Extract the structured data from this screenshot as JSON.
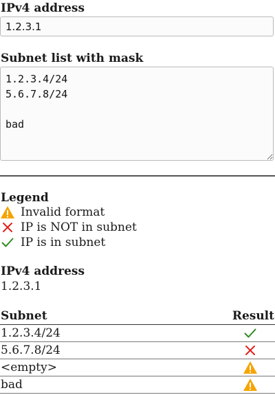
{
  "form": {
    "ip_label": "IPv4 address",
    "ip_value": "1.2.3.1",
    "subnets_label": "Subnet list with mask",
    "subnets_value": "1.2.3.4/24\n5.6.7.8/24\n\nbad"
  },
  "legend": {
    "title": "Legend",
    "items": [
      {
        "icon": "warning-icon",
        "text": "Invalid format",
        "color": "#f5a400"
      },
      {
        "icon": "cross-icon",
        "text": "IP is NOT in subnet",
        "color": "#e0201b"
      },
      {
        "icon": "check-icon",
        "text": "IP is in subnet",
        "color": "#2e8b1e"
      }
    ]
  },
  "summary": {
    "ip_title": "IPv4 address",
    "ip_value": "1.2.3.1"
  },
  "results": {
    "headers": {
      "subnet": "Subnet",
      "result": "Result"
    },
    "rows": [
      {
        "subnet": "1.2.3.4/24",
        "result": "check-icon"
      },
      {
        "subnet": "5.6.7.8/24",
        "result": "cross-icon"
      },
      {
        "subnet": "<empty>",
        "result": "warning-icon"
      },
      {
        "subnet": "bad",
        "result": "warning-icon"
      }
    ]
  }
}
